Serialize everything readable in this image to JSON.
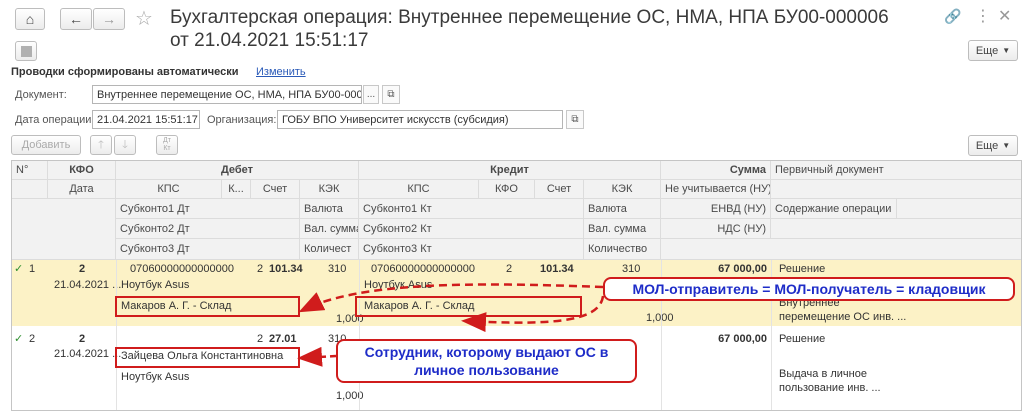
{
  "window": {
    "title_line1": "Бухгалтерская операция: Внутреннее перемещение ОС, НМА, НПА БУ00-000006",
    "title_line2": "от 21.04.2021 15:51:17",
    "more_button": "Еще",
    "home_icon": "home-icon",
    "back_icon": "arrow-left-icon",
    "forward_icon": "arrow-right-icon",
    "star_icon": "star-icon",
    "link_icon": "link-icon",
    "menu_icon": "more-vert-icon",
    "close_icon": "close-icon"
  },
  "form": {
    "postings_label": "Проводки сформированы автоматически",
    "change_link": "Изменить",
    "document_label": "Документ:",
    "document_value": "Внутреннее перемещение ОС, НМА, НПА БУ00-000006",
    "date_label": "Дата операции:",
    "date_value": "21.04.2021 15:51:17",
    "org_label": "Организация:",
    "org_value": "ГОБУ ВПО Университет искусств (субсидия)",
    "ellipsis": "...",
    "add_button": "Добавить",
    "dt_kt_button": "Дт\nКт",
    "more_button": "Еще"
  },
  "table": {
    "headers": {
      "num": "N°",
      "kfo": "КФО",
      "date": "Дата",
      "debit": "Дебет",
      "credit": "Кредит",
      "sum": "Сумма",
      "primary_doc": "Первичный документ",
      "kps_dt": "КПС",
      "k_dt": "К...",
      "account_dt": "Счет",
      "kek_dt": "КЭК",
      "kps_kt": "КПС",
      "kfo_kt": "КФО",
      "account_kt": "Счет",
      "kek_kt": "КЭК",
      "not_counted": "Не учитывается (НУ)",
      "sub1_dt": "Субконто1 Дт",
      "currency_dt": "Валюта",
      "sub1_kt": "Субконто1 Кт",
      "currency_kt": "Валюта",
      "envd": "ЕНВД (НУ)",
      "content": "Содержание операции",
      "sub2_dt": "Субконто2 Дт",
      "cur_sum_dt": "Вал. сумма",
      "sub2_kt": "Субконто2 Кт",
      "cur_sum_kt": "Вал. сумма",
      "vat": "НДС (НУ)",
      "sub3_dt": "Субконто3 Дт",
      "qty_dt": "Количест",
      "sub3_kt": "Субконто3 Кт",
      "qty_kt": "Количество"
    },
    "rows": [
      {
        "num": "1",
        "kfo": "2",
        "date": "21.04.2021 ...",
        "kps_dt": "07060000000000000",
        "k_dt": "2",
        "account_dt": "101.34",
        "kek_dt": "310",
        "kps_kt": "07060000000000000",
        "kfo_kt": "2",
        "account_kt": "101.34",
        "kek_kt": "310",
        "sum": "67 000,00",
        "primary_doc": "Решение",
        "sub1_dt": "Ноутбук Asus",
        "sub1_kt": "Ноутбук Asus",
        "sub2_dt": "Макаров А. Г. - Склад",
        "sub2_kt": "Макаров А. Г. - Склад",
        "content1": "Внутреннее",
        "content2": "перемещение ОС инв. ...",
        "qty_dt": "1,000",
        "qty_kt": "1,000"
      },
      {
        "num": "2",
        "kfo": "2",
        "date": "21.04.2021 ...",
        "k_dt": "2",
        "account_dt": "27.01",
        "kek_dt": "310",
        "sum": "67 000,00",
        "primary_doc": "Решение",
        "sub1_dt": "Зайцева Ольга Константиновна",
        "sub2_dt": "Ноутбук Asus",
        "content1": "Выдача в личное",
        "content2": "пользование инв. ...",
        "qty_dt": "1,000"
      }
    ]
  },
  "annotations": {
    "callout1": "МОЛ-отправитель = МОЛ-получатель = кладовщик",
    "callout2_line1": "Сотрудник, которому выдают ОС в",
    "callout2_line2": "личное пользование"
  },
  "colors": {
    "selected_row": "#fcf2c6",
    "annotation_red": "#d01c1c",
    "annotation_blue": "#1e2cc8",
    "link": "#2a5ab8",
    "check_green": "#2f8f2f"
  }
}
